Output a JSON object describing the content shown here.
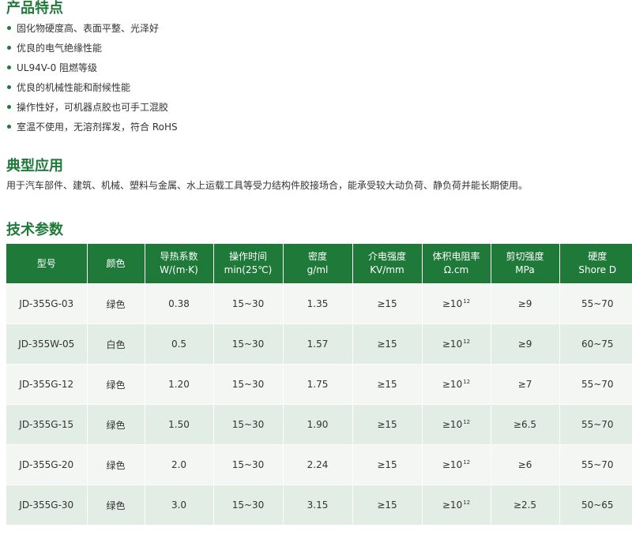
{
  "features": {
    "title": "产品特点",
    "items": [
      "固化物硬度高、表面平整、光泽好",
      "优良的电气绝缘性能",
      "UL94V-0 阻燃等级",
      "优良的机械性能和耐候性能",
      "操作性好，可机器点胶也可手工混胶",
      "室温不使用，无溶剂挥发，符合 RoHS"
    ]
  },
  "application": {
    "title": "典型应用",
    "text": "用于汽车部件、建筑、机械、塑料与金属、水上运载工具等受力结构件胶接场合，能承受较大动负荷、静负荷并能长期使用。"
  },
  "specs": {
    "title": "技术参数",
    "headers": [
      [
        "型号"
      ],
      [
        "颜色"
      ],
      [
        "导热系数",
        "W/(m·K)"
      ],
      [
        "操作时间",
        "min(25℃)"
      ],
      [
        "密度",
        "g/ml"
      ],
      [
        "介电强度",
        "KV/mm"
      ],
      [
        "体积电阻率",
        "Ω.cm"
      ],
      [
        "剪切强度",
        "MPa"
      ],
      [
        "硬度",
        "Shore D"
      ]
    ],
    "rows": [
      [
        "JD-355G-03",
        "绿色",
        "0.38",
        "15~30",
        "1.35",
        "≥15",
        "≥10",
        "≥9",
        "55~70"
      ],
      [
        "JD-355W-05",
        "白色",
        "0.5",
        "15~30",
        "1.57",
        "≥15",
        "≥10",
        "≥9",
        "60~75"
      ],
      [
        "JD-355G-12",
        "绿色",
        "1.20",
        "15~30",
        "1.75",
        "≥15",
        "≥10",
        "≥7",
        "55~70"
      ],
      [
        "JD-355G-15",
        "绿色",
        "1.50",
        "15~30",
        "1.90",
        "≥15",
        "≥10",
        "≥6.5",
        "55~70"
      ],
      [
        "JD-355G-20",
        "绿色",
        "2.0",
        "15~30",
        "2.24",
        "≥15",
        "≥10",
        "≥6",
        "55~70"
      ],
      [
        "JD-355G-30",
        "绿色",
        "3.0",
        "15~30",
        "3.15",
        "≥15",
        "≥10",
        "≥2.5",
        "50~65"
      ]
    ],
    "resistivity_exponent": "12"
  },
  "colors": {
    "accent": "#1f7a3a",
    "row_light": "#f4f6f4",
    "row_tint": "#e1ede5"
  }
}
